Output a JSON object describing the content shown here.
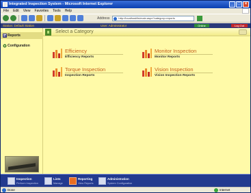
{
  "browser": {
    "title": "Integrated Inspection System - Microsoft Internet Explorer",
    "menu": [
      "File",
      "Edit",
      "View",
      "Favorites",
      "Tools",
      "Help"
    ],
    "address_label": "Address",
    "address_value": "http://localhost/iis/main.aspx?category=reports"
  },
  "appbar": {
    "station": "Station: Default Station",
    "user": "User: Administrator",
    "green_button": "Online",
    "red_button": "Log Out"
  },
  "sidebar": {
    "items": [
      {
        "label": "Reports",
        "icon": "report-icon"
      },
      {
        "label": "Configuration",
        "icon": "configuration-icon"
      }
    ]
  },
  "main": {
    "heading": "Select a Category",
    "categories": [
      {
        "title": "Efficiency",
        "link": "Efficiency Reports"
      },
      {
        "title": "Monitor Inspection",
        "link": "Monitor Reports"
      },
      {
        "title": "Torque Inspection",
        "link": "Inspection Reports"
      },
      {
        "title": "Vision Inspection",
        "link": "Vision Inspection Reports"
      }
    ]
  },
  "bottom_nav": [
    {
      "label": "Inspection",
      "sub": "Perform Inspection"
    },
    {
      "label": "Lists",
      "sub": "Manage"
    },
    {
      "label": "Reporting",
      "sub": "View Reports"
    },
    {
      "label": "Administration",
      "sub": "System Configuration"
    }
  ],
  "statusbar": {
    "left": "Done",
    "zone": "Internet"
  },
  "colors": {
    "accent": "#c25d1a",
    "sidebar_bg": "#fffaa8",
    "nav_bg": "#233a8f"
  }
}
